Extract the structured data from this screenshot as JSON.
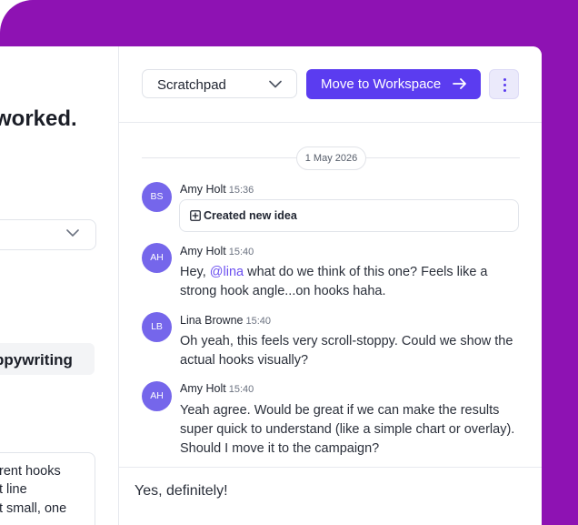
{
  "left": {
    "title_fragment": "worked.",
    "chip_fragment": "ppywriting",
    "card_lines": [
      "rent hooks",
      "t line",
      "t small, one",
      "..."
    ]
  },
  "toolbar": {
    "select_value": "Scratchpad",
    "move_label": "Move to Workspace"
  },
  "chat": {
    "date": "1 May 2026",
    "messages": [
      {
        "initials": "BS",
        "author": "Amy Holt",
        "time": "15:36",
        "card": "Created new idea"
      },
      {
        "initials": "AH",
        "author": "Amy Holt",
        "time": "15:40",
        "before": "Hey, ",
        "mention": "@lina",
        "after": " what do we think of this one? Feels like a strong hook angle...on hooks haha."
      },
      {
        "initials": "LB",
        "author": "Lina Browne",
        "time": "15:40",
        "text": "Oh yeah, this feels very scroll-stoppy. Could we show the actual hooks visually?"
      },
      {
        "initials": "AH",
        "author": "Amy Holt",
        "time": "15:40",
        "text": "Yeah agree. Would be great if we can make the results super quick to understand (like a simple chart or overlay). Should I move it to the campaign?"
      }
    ]
  },
  "composer": {
    "value": "Yes, definitely!"
  },
  "colors": {
    "accent": "#5b3cf0",
    "frame": "#8e12b3",
    "avatar": "#7566eb"
  }
}
